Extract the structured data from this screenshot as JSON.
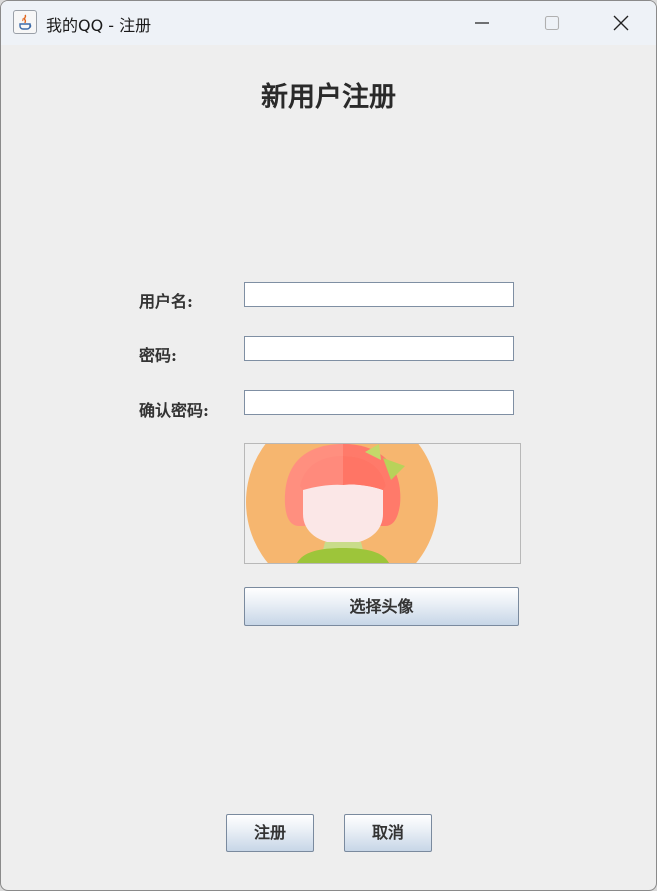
{
  "window": {
    "title": "我的QQ - 注册",
    "controls": {
      "minimize": "minimize-icon",
      "maximize": "maximize-icon",
      "close": "close-icon"
    }
  },
  "form": {
    "heading": "新用户注册",
    "username_label": "用户名:",
    "username_value": "",
    "password_label": "密码:",
    "password_value": "",
    "confirm_label": "确认密码:",
    "confirm_value": ""
  },
  "avatar": {
    "icon": "avatar-image"
  },
  "buttons": {
    "choose_avatar": "选择头像",
    "register": "注册",
    "cancel": "取消"
  },
  "colors": {
    "window_bg": "#eeeeee",
    "titlebar_bg": "#eef2f7",
    "button_gradient_end": "#c7d6e7"
  }
}
